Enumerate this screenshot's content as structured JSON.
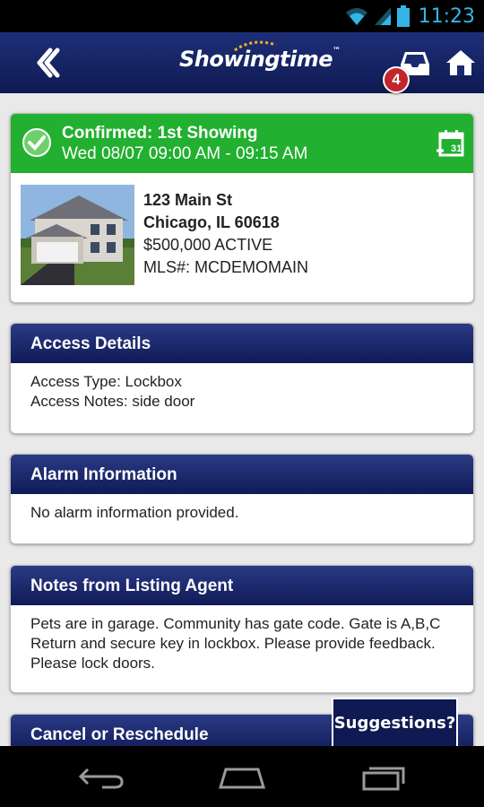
{
  "status_bar": {
    "time": "11:23"
  },
  "header": {
    "logo_text": "Showingtime",
    "logo_tm": "™",
    "inbox_badge": "4"
  },
  "showing": {
    "status": "Confirmed: 1st Showing",
    "datetime": "Wed 08/07 09:00 AM - 09:15 AM",
    "address_line1": "123 Main St",
    "address_line2": "Chicago, IL 60618",
    "price_status": "$500,000 ACTIVE",
    "mls": "MLS#: MCDEMOMAIN"
  },
  "access": {
    "title": "Access Details",
    "type_label": "Access Type:",
    "type_value": "Lockbox",
    "notes_label": "Access Notes:",
    "notes_value": "side door"
  },
  "alarm": {
    "title": "Alarm Information",
    "text": "No alarm information provided."
  },
  "notes": {
    "title": "Notes from Listing Agent",
    "text": "Pets are in garage. Community has gate code. Gate is A,B,C Return and secure key in lockbox. Please provide feedback. Please lock doors."
  },
  "cancel": {
    "title": "Cancel or Reschedule"
  },
  "suggestions_label": "Suggestions?",
  "colors": {
    "header_navy": "#101b57",
    "confirm_green": "#21b02f",
    "badge_red": "#c0262b",
    "status_blue": "#33b5e5"
  }
}
